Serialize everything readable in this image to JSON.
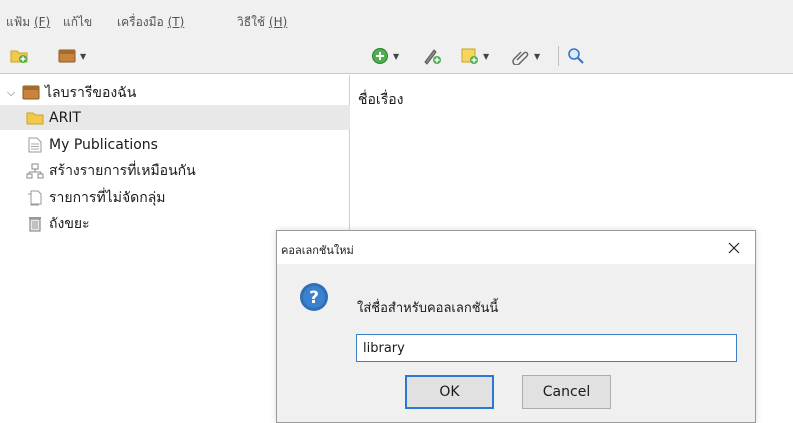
{
  "menubar": {
    "items": [
      {
        "label": "แฟ้ม",
        "mnemonic": "(F)"
      },
      {
        "label": "แก้ไข",
        "mnemonic": ""
      },
      {
        "label": "เครื่องมือ",
        "mnemonic": "(T)"
      },
      {
        "label": "วิธีใช้",
        "mnemonic": "(H)"
      }
    ]
  },
  "toolbar": {
    "icons": [
      "new-collection-icon",
      "library-menu-icon",
      "new-item-icon",
      "add-by-identifier-icon",
      "new-note-icon",
      "attachment-icon",
      "search-icon"
    ]
  },
  "collections": {
    "root_label": "ไลบรารีของฉัน",
    "items": [
      {
        "label": "ARIT",
        "icon": "folder-icon"
      },
      {
        "label": "My Publications",
        "icon": "document-icon"
      },
      {
        "label": "สร้างรายการที่เหมือนกัน",
        "icon": "duplicate-items-icon"
      },
      {
        "label": "รายการที่ไม่จัดกลุ่ม",
        "icon": "unfiled-items-icon"
      },
      {
        "label": "ถังขยะ",
        "icon": "trash-icon"
      }
    ]
  },
  "items_pane": {
    "column_title": "ชื่อเรื่อง"
  },
  "dialog": {
    "title": "คอลเลกชันใหม่",
    "prompt": "ใส่ชื่อสำหรับคอลเลกชันนี้",
    "input_value": "library",
    "ok_label": "OK",
    "cancel_label": "Cancel"
  },
  "colors": {
    "accent": "#2a78d4",
    "folder": "#f2c94c",
    "question_icon": "#2f6fb5"
  }
}
